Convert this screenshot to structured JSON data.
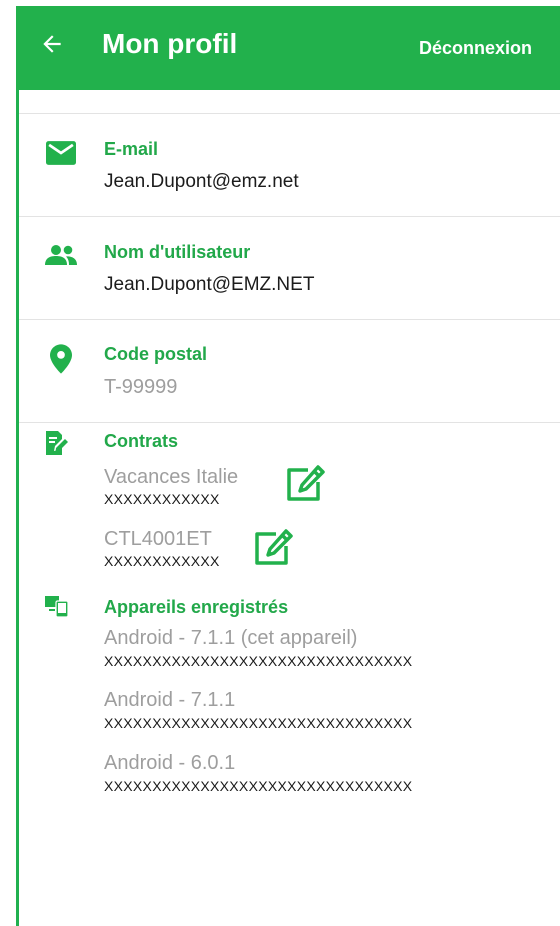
{
  "appbar": {
    "title": "Mon profil",
    "logout_label": "Déconnexion",
    "back_icon": "arrow-left-icon"
  },
  "fields": {
    "email": {
      "label": "E-mail",
      "value": "Jean.Dupont@emz.net",
      "icon": "envelope-icon"
    },
    "username": {
      "label": "Nom d'utilisateur",
      "value": "Jean.Dupont@EMZ.NET",
      "icon": "people-icon"
    },
    "postal": {
      "label": "Code postal",
      "value": "T-99999",
      "icon": "location-pin-icon"
    }
  },
  "contracts": {
    "label": "Contrats",
    "icon": "document-edit-icon",
    "items": [
      {
        "name": "Vacances Italie",
        "code": "XXXXXXXXXXXX"
      },
      {
        "name": "CTL4001ET",
        "code": "XXXXXXXXXXXX"
      }
    ]
  },
  "devices": {
    "label": "Appareils enregistrés",
    "icon": "devices-icon",
    "items": [
      {
        "name": "Android - 7.1.1 (cet appareil)",
        "id": "XXXXXXXXXXXXXXXXXXXXXXXXXXXXXXXX"
      },
      {
        "name": "Android - 7.1.1",
        "id": "XXXXXXXXXXXXXXXXXXXXXXXXXXXXXXXX"
      },
      {
        "name": "Android - 6.0.1",
        "id": "XXXXXXXXXXXXXXXXXXXXXXXXXXXXXXXX"
      }
    ]
  },
  "colors": {
    "accent": "#22b14c",
    "label_green": "#22a84a",
    "muted": "#9e9e9e",
    "text": "#1c1c1c"
  }
}
